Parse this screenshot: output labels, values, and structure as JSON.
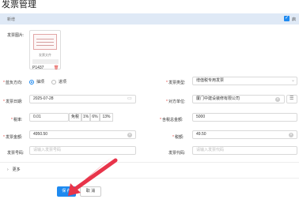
{
  "page_title": "发票管理",
  "new_bar": {
    "label": "新增",
    "checkbox_label": "启"
  },
  "form": {
    "image": {
      "label": "发票图片:",
      "thumb_caption": "发票文件",
      "file_name": "P1437"
    },
    "direction": {
      "label": "蓝负方向:",
      "options": [
        "抽项",
        "进项"
      ],
      "selected": 0
    },
    "invoice_type": {
      "label": "发票类型:",
      "value": "增值税专用发票"
    },
    "invoice_date": {
      "label": "发票日期:",
      "value": "2025-07-28"
    },
    "counterparty": {
      "label": "对方单位:",
      "value": "厦门中建设装修有限公司"
    },
    "tax_rate": {
      "label": "税率:",
      "value": "0.01",
      "buttons": [
        "免税",
        "1%",
        "6%",
        "13%"
      ]
    },
    "total_with_tax": {
      "label": "含税总金额:",
      "value": "5000"
    },
    "invoice_amount": {
      "label": "发票金额:",
      "value": "4950.50"
    },
    "tax_amount": {
      "label": "税额:",
      "value": "49.50"
    },
    "invoice_number": {
      "label": "发票号码:",
      "placeholder": "请输入发票号码"
    },
    "invoice_code": {
      "label": "发票代码:",
      "placeholder": "请输入发票代码"
    },
    "more": "更多"
  },
  "actions": {
    "save": "保 存",
    "cancel": "取 消"
  },
  "icons": {
    "calendar": "calendar-icon",
    "clear": "clear-circle-icon",
    "list": "list-icon",
    "chevron": "chevron-down-icon",
    "delete": "trash-icon"
  },
  "colors": {
    "primary": "#1e8af0",
    "required": "#e0403a",
    "arrow": "#e8344a"
  }
}
